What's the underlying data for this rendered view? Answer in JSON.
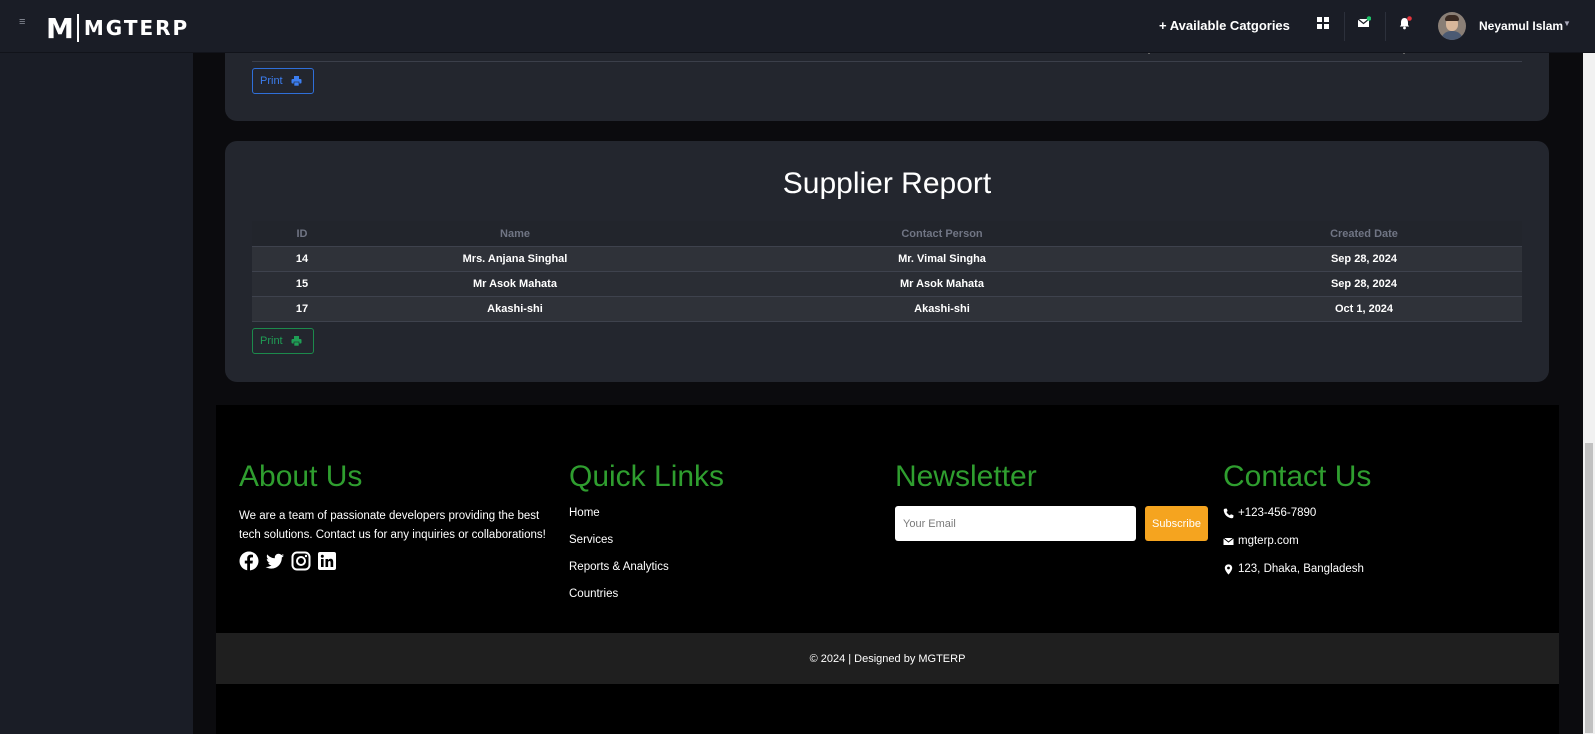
{
  "topbar": {
    "brand_mark": "M",
    "brand_text": "MGTERP",
    "available_categories": "+ Available Catgories",
    "username": "Neyamul Islam"
  },
  "print_label": "Print",
  "supplier_report": {
    "title": "Supplier Report",
    "columns": [
      "ID",
      "Name",
      "Contact Person",
      "Created Date"
    ],
    "rows": [
      {
        "id": "14",
        "name": "Mrs. Anjana Singhal",
        "contact": "Mr. Vimal Singha",
        "date": "Sep 28, 2024"
      },
      {
        "id": "15",
        "name": "Mr Asok Mahata",
        "contact": "Mr Asok Mahata",
        "date": "Sep 28, 2024"
      },
      {
        "id": "17",
        "name": "Akashi-shi",
        "contact": "Akashi-shi",
        "date": "Oct 1, 2024"
      }
    ]
  },
  "footer": {
    "about": {
      "title": "About Us",
      "text": "We are a team of passionate developers providing the best tech solutions. Contact us for any inquiries or collaborations!"
    },
    "quick_links": {
      "title": "Quick Links",
      "items": [
        "Home",
        "Services",
        "Reports & Analytics",
        "Countries"
      ]
    },
    "newsletter": {
      "title": "Newsletter",
      "placeholder": "Your Email",
      "button": "Subscribe"
    },
    "contact": {
      "title": "Contact Us",
      "phone": "+123-456-7890",
      "email": "mgterp.com",
      "address": "123, Dhaka, Bangladesh"
    },
    "copyright": "© 2024 | Designed by MGTERP"
  },
  "colors": {
    "accent_green": "#2f9e2f",
    "subscribe_orange": "#f5a41f",
    "print_blue": "#3c7ef0",
    "print_green": "#1f9e55"
  }
}
